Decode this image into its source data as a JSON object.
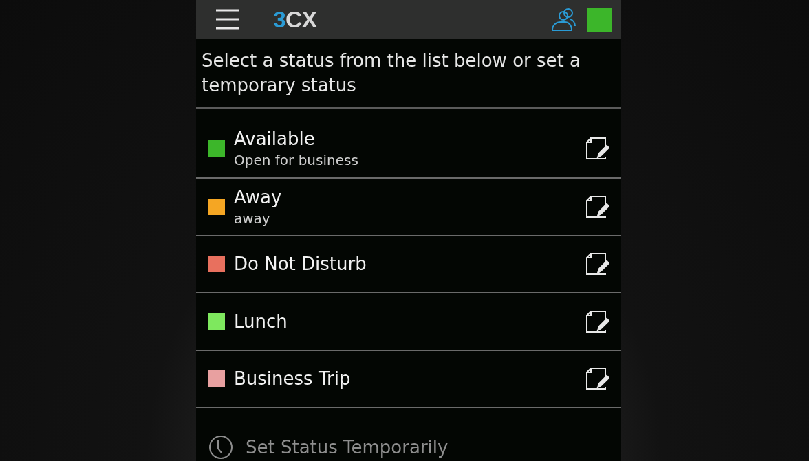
{
  "header": {
    "logo": {
      "accent": "3",
      "rest": "CX"
    },
    "status_indicator": {
      "color": "#3cb62a"
    }
  },
  "prompt": "Select a status from the list below or set a temporary status",
  "statuses": [
    {
      "name": "Available",
      "description": "Open for business",
      "color": "#3cb62a"
    },
    {
      "name": "Away",
      "description": "away",
      "color": "#f5a623"
    },
    {
      "name": "Do Not Disturb",
      "color": "#e8705e"
    },
    {
      "name": "Lunch",
      "color": "#7ee85e"
    },
    {
      "name": "Business Trip",
      "color": "#e8a0a0"
    }
  ],
  "temporary_action": "Set Status Temporarily"
}
